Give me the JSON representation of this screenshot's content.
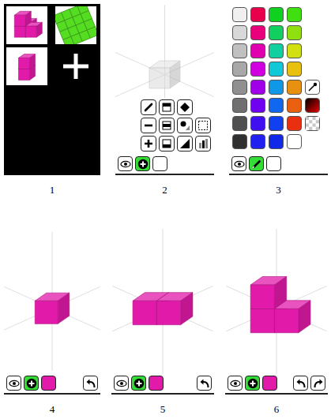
{
  "figures": [
    {
      "caption": "1",
      "kind": "gallery",
      "projects": [
        {
          "kind": "model",
          "color": "#e21aa9",
          "voxels": [
            [
              0,
              0,
              0
            ],
            [
              1,
              0,
              0
            ],
            [
              0,
              1,
              0
            ],
            [
              0,
              0,
              1
            ]
          ]
        },
        {
          "kind": "layer",
          "color": "#55dd22"
        },
        {
          "kind": "model",
          "color": "#e21aa9",
          "voxels": [
            [
              0,
              0,
              0
            ],
            [
              0,
              1,
              0
            ]
          ]
        },
        {
          "kind": "new"
        }
      ]
    },
    {
      "caption": "2",
      "kind": "tools",
      "scene": {
        "color": "#d9d9d9",
        "translucent": true,
        "voxels": [
          [
            0,
            0,
            0
          ]
        ]
      },
      "tools": [
        [
          {
            "kind": "pencil"
          },
          {
            "kind": "fill-top"
          },
          {
            "kind": "diamond"
          }
        ],
        [
          {
            "kind": "minus"
          },
          {
            "kind": "fill-mid"
          },
          {
            "kind": "shapes"
          },
          {
            "kind": "select"
          }
        ],
        [
          {
            "kind": "plus"
          },
          {
            "kind": "fill-bottom"
          },
          {
            "kind": "triangle"
          },
          {
            "kind": "bars"
          }
        ]
      ],
      "toolbar": [
        {
          "kind": "view",
          "selected": false
        },
        {
          "kind": "add",
          "selected": true
        },
        {
          "kind": "blank",
          "selected": false
        }
      ]
    },
    {
      "caption": "3",
      "kind": "palette",
      "swatches": [
        [
          "#f0f0f0",
          "#e8004c",
          "#10d020",
          "#40e010"
        ],
        [
          "#d8d8d8",
          "#e8007c",
          "#10d060",
          "#90e010"
        ],
        [
          "#c0c0c0",
          "#e000b0",
          "#10d0a0",
          "#d0e010"
        ],
        [
          "#a8a8a8",
          "#d000e0",
          "#10c8d8",
          "#e8c010"
        ],
        [
          "#909090",
          "#a000e8",
          "#1098e8",
          "#e89010"
        ],
        [
          "#707070",
          "#7000f0",
          "#1068f0",
          "#e86010"
        ],
        [
          "#505050",
          "#4010f0",
          "#1040f0",
          "#e83010"
        ],
        [
          "#303030",
          "#2020f0",
          "#1028e8",
          "#ffffff"
        ]
      ],
      "extras": [
        {
          "kind": "eyedropper"
        },
        {
          "kind": "gradient"
        },
        {
          "kind": "transparent"
        }
      ],
      "toolbar": [
        {
          "kind": "view",
          "selected": false
        },
        {
          "kind": "pencil",
          "selected": true
        },
        {
          "kind": "blank",
          "selected": false
        }
      ]
    },
    {
      "caption": "4",
      "kind": "editor",
      "scene": {
        "color": "#e21aa9",
        "translucent": false,
        "voxels": [
          [
            0,
            0,
            0
          ]
        ]
      },
      "toolbar": [
        {
          "kind": "view",
          "selected": false
        },
        {
          "kind": "add",
          "selected": true
        },
        {
          "kind": "color",
          "color": "#e21aa9",
          "selected": false
        },
        {
          "kind": "undo",
          "selected": false
        }
      ]
    },
    {
      "caption": "5",
      "kind": "editor",
      "scene": {
        "color": "#e21aa9",
        "translucent": false,
        "voxels": [
          [
            0,
            0,
            0
          ],
          [
            1,
            0,
            0
          ]
        ]
      },
      "toolbar": [
        {
          "kind": "view",
          "selected": false
        },
        {
          "kind": "add",
          "selected": true
        },
        {
          "kind": "color",
          "color": "#e21aa9",
          "selected": false
        },
        {
          "kind": "undo",
          "selected": false
        }
      ]
    },
    {
      "caption": "6",
      "kind": "editor",
      "scene": {
        "color": "#e21aa9",
        "translucent": false,
        "voxels": [
          [
            0,
            0,
            0
          ],
          [
            1,
            0,
            0
          ],
          [
            0,
            1,
            0
          ]
        ]
      },
      "toolbar": [
        {
          "kind": "view",
          "selected": false
        },
        {
          "kind": "add",
          "selected": true
        },
        {
          "kind": "color",
          "color": "#e21aa9",
          "selected": false
        },
        {
          "kind": "undo",
          "selected": false
        },
        {
          "kind": "redo",
          "selected": false
        }
      ]
    }
  ]
}
